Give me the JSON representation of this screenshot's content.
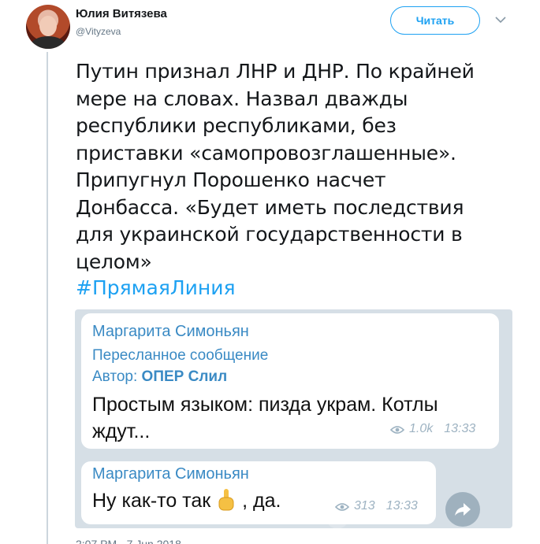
{
  "author": {
    "name": "Юлия Витязева",
    "handle": "@Vityzeva"
  },
  "follow_button": {
    "label": "Читать"
  },
  "tweet": {
    "text": "Путин признал ЛНР и ДНР. По крайней\nмере на словах. Назвал дважды\nреспублики республиками, без\nприставки «самопровозглашенные».\nПрипугнул Порошенко насчет\nДонбасса. «Будет иметь последствия\nдля украинской государственности в\nцелом»",
    "hashtag": "#ПрямаяЛиния"
  },
  "telegram": {
    "message1": {
      "sender": "Маргарита Симоньян",
      "forwarded_label": "Пересланное сообщение",
      "author_label": "Автор:",
      "author_name": "ОПЕР Слил",
      "text_line1": "Простым языком: пизда украм. Котлы",
      "text_line2": "ждут...",
      "views": "1.0k",
      "time": "13:33"
    },
    "message2": {
      "sender": "Маргарита Симоньян",
      "text_before": "Ну как-то так",
      "text_after": ", да.",
      "views": "313",
      "time": "13:33"
    }
  },
  "footer_partial": "2:07 PM - 7 Jun 2018",
  "icons": {
    "menu": "chevron-down-icon",
    "views": "eye-icon",
    "share": "share-arrow-icon",
    "emoji": "pointing-finger-emoji"
  },
  "colors": {
    "twitter_blue": "#1da1f2",
    "telegram_link": "#3a8ac4"
  }
}
